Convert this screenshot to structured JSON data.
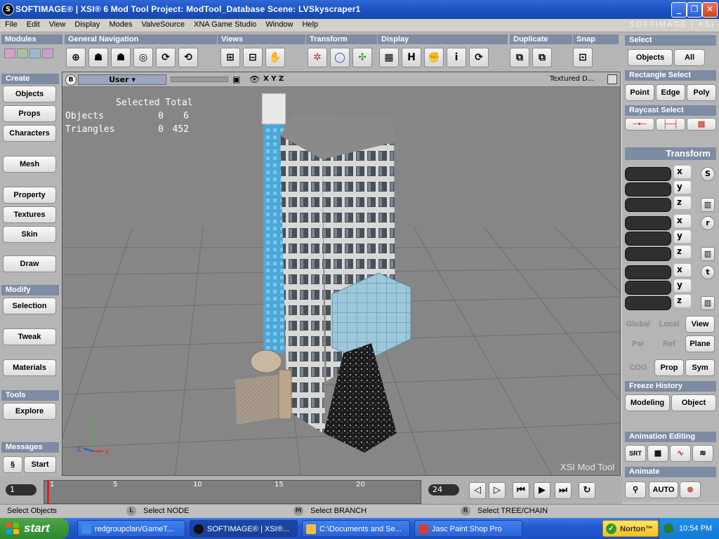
{
  "window": {
    "title": "SOFTIMAGE® | XSI® 6 Mod Tool Project: ModTool_Database     Scene: LVSkyscraper1",
    "app_icon_letter": "S",
    "minimize": "_",
    "maximize": "❐",
    "close": "✕"
  },
  "menu": {
    "items": [
      "File",
      "Edit",
      "View",
      "Display",
      "Modes",
      "ValveSource",
      "XNA Game Studio",
      "Window",
      "Help"
    ],
    "brand": "SOFTIMAGE | XSI"
  },
  "toolbar": {
    "modules": "Modules",
    "general_navigation": "General Navigation",
    "views": "Views",
    "transform": "Transform",
    "display": "Display",
    "duplicate": "Duplicate",
    "snap": "Snap",
    "display_h": "H",
    "display_i": "i"
  },
  "left_panel": {
    "create_header": "Create",
    "objects": "Objects",
    "props": "Props",
    "characters": "Characters",
    "mesh": "Mesh",
    "property": "Property",
    "textures": "Textures",
    "skin": "Skin",
    "draw": "Draw",
    "modify_header": "Modify",
    "selection": "Selection",
    "tweak": "Tweak",
    "materials": "Materials",
    "tools_header": "Tools",
    "explore": "Explore",
    "messages_header": "Messages",
    "start": "Start"
  },
  "viewport": {
    "badge": "B",
    "camera": "User",
    "axes": "X Y Z",
    "shading": "Textured D...",
    "stats_header": "Selected Total",
    "stats": [
      {
        "label": "Objects",
        "selected": "0",
        "total": "6"
      },
      {
        "label": "Triangles",
        "selected": "0",
        "total": "452"
      }
    ],
    "watermark": "XSI Mod Tool",
    "gizmo": {
      "x": "X",
      "y": "Y",
      "z": "Z"
    }
  },
  "right_panel": {
    "select_header": "Select",
    "objects": "Objects",
    "all": "All",
    "rect_header": "Rectangle Select",
    "point": "Point",
    "edge": "Edge",
    "poly": "Poly",
    "raycast_header": "Raycast Select",
    "transform_header": "Transform",
    "s": "S",
    "r": "r",
    "t": "t",
    "x": "x",
    "y": "y",
    "z": "z",
    "global": "Global",
    "local": "Local",
    "view": "View",
    "par": "Par",
    "ref": "Ref",
    "plane": "Plane",
    "cog": "COG",
    "prop": "Prop",
    "sym": "Sym",
    "freeze_header": "Freeze History",
    "modeling": "Modeling",
    "object": "Object",
    "anim_editing_header": "Animation Editing",
    "srt": "SRT",
    "animate_header": "Animate",
    "auto": "AUTO"
  },
  "timeline": {
    "start_frame": "1",
    "end_frame": "24",
    "ticks": [
      "1",
      "5",
      "10",
      "15",
      "20"
    ]
  },
  "statusbar": {
    "left_text": "Select Objects",
    "l_key": "L",
    "l_text": "Select NODE",
    "m_key": "M",
    "m_text": "Select BRANCH",
    "r_key": "R",
    "r_text": "Select TREE/CHAIN"
  },
  "taskbar": {
    "start": "start",
    "items": [
      "redgroupclan/GameT...",
      "SOFTIMAGE® | XSI®...",
      "C:\\Documents and Se...",
      "Jasc Paint Shop Pro"
    ],
    "norton": "Norton™",
    "clock": "10:54 PM"
  }
}
